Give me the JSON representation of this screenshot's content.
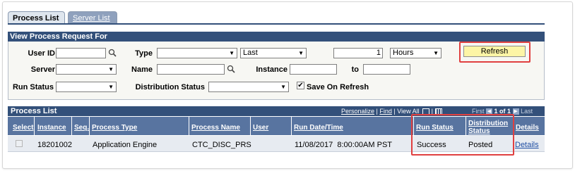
{
  "tabs": {
    "process_list": "Process List",
    "server_list": "Server List"
  },
  "criteria": {
    "title": "View Process Request For",
    "user_id_label": "User ID",
    "user_id_value": "",
    "type_label": "Type",
    "type_value": "",
    "period_value": "Last",
    "count_value": "1",
    "unit_value": "Hours",
    "refresh_label": "Refresh",
    "server_label": "Server",
    "server_value": "",
    "name_label": "Name",
    "name_value": "",
    "instance_label": "Instance",
    "instance_from": "",
    "to_label": "to",
    "instance_to": "",
    "run_status_label": "Run Status",
    "run_status_value": "",
    "dist_status_label": "Distribution Status",
    "dist_status_value": "",
    "save_on_refresh_label": "Save On Refresh",
    "save_on_refresh_checked": true
  },
  "process_list": {
    "title": "Process List",
    "personalize": "Personalize",
    "find": "Find",
    "view_all": "View All",
    "first": "First",
    "range": "1 of 1",
    "last": "Last",
    "columns": [
      "Select",
      "Instance",
      "Seq.",
      "Process Type",
      "Process Name",
      "User",
      "Run Date/Time",
      "Run Status",
      "Distribution Status",
      "Details"
    ],
    "rows": [
      {
        "instance": "18201002",
        "seq": "",
        "process_type": "Application Engine",
        "process_name": "CTC_DISC_PRS",
        "user": "",
        "run_datetime": "11/08/2017  8:00:00AM PST",
        "run_status": "Success",
        "distribution_status": "Posted",
        "details": "Details"
      }
    ]
  },
  "colors": {
    "header_blue": "#33507a",
    "column_blue": "#5874a0",
    "refresh_yellow": "#fdf5a6",
    "highlight_red": "#e04040"
  }
}
